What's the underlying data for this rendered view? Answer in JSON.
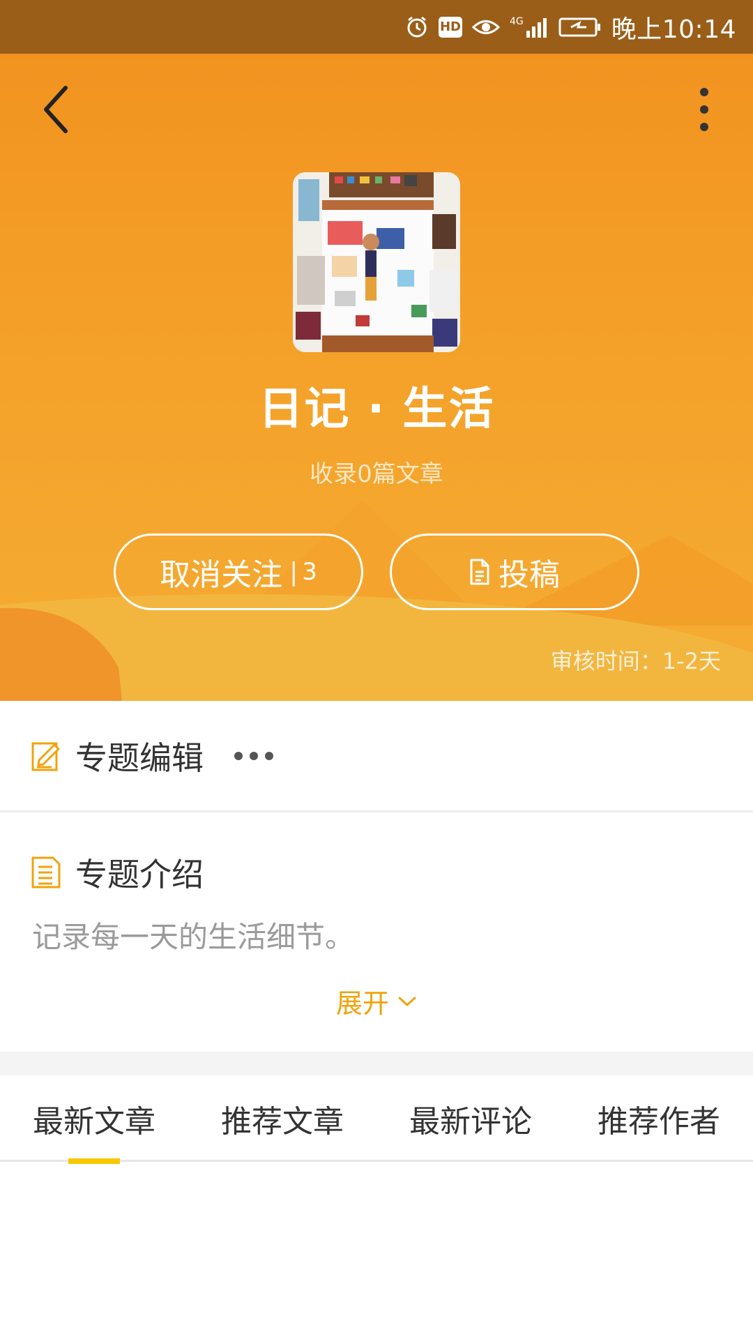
{
  "status_bar": {
    "time": "晚上10:14",
    "network_label": "4G",
    "hd_label": "HD",
    "icons": [
      "alarm-icon",
      "hd-icon",
      "eye-icon",
      "signal-icon",
      "battery-icon"
    ]
  },
  "header": {
    "back_icon": "back-arrow-icon",
    "more_icon": "more-vertical-icon",
    "title": "日记 · 生活",
    "subtitle": "收录0篇文章",
    "follow_button": {
      "label": "取消关注",
      "separator": "|",
      "count": "3"
    },
    "submit_button": {
      "label": "投稿",
      "icon": "document-icon"
    },
    "review_time": "审核时间：1-2天"
  },
  "editor_section": {
    "title": "专题编辑",
    "icon": "edit-icon"
  },
  "intro_section": {
    "title": "专题介绍",
    "icon": "document-list-icon",
    "text": "记录每一天的生活细节。",
    "expand_label": "展开"
  },
  "tabs": [
    {
      "label": "最新文章",
      "active": true
    },
    {
      "label": "推荐文章",
      "active": false
    },
    {
      "label": "最新评论",
      "active": false
    },
    {
      "label": "推荐作者",
      "active": false
    }
  ],
  "colors": {
    "accent": "#f7c800",
    "header_orange": "#f29320",
    "expand_text": "#f0a30a"
  }
}
